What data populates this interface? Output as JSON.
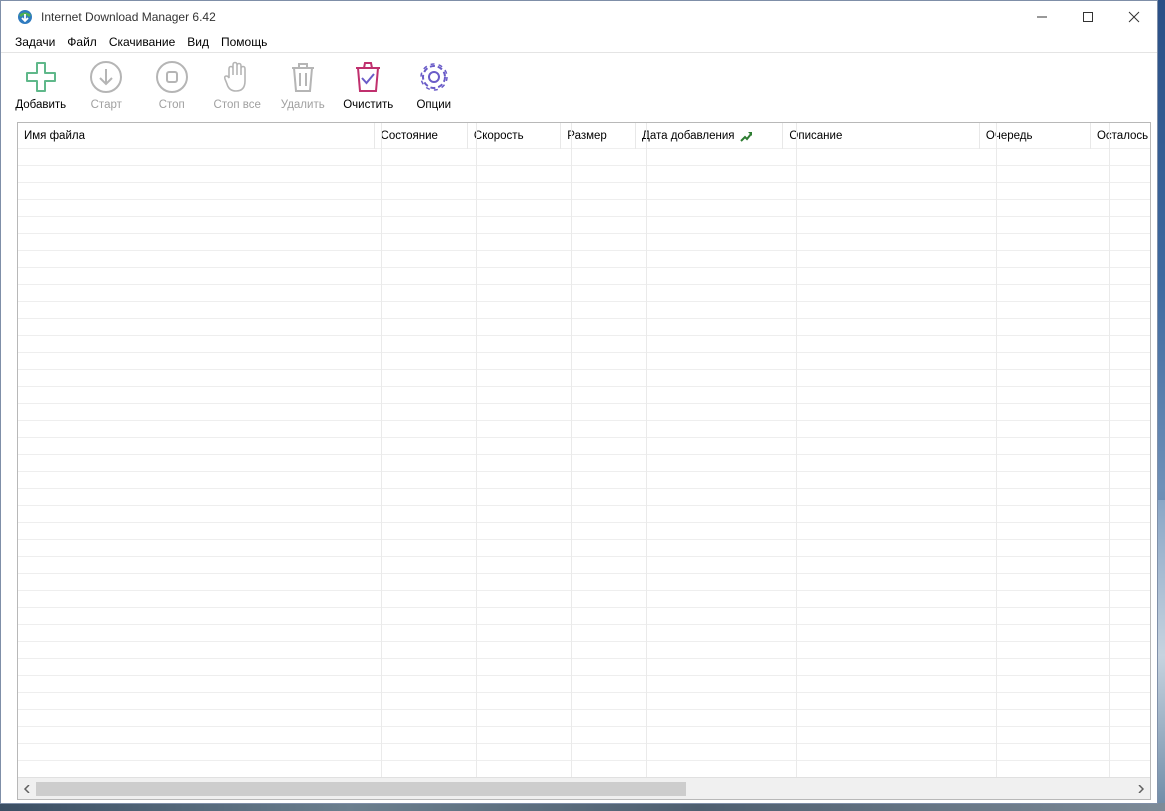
{
  "window": {
    "title": "Internet Download Manager 6.42"
  },
  "menu": [
    "Задачи",
    "Файл",
    "Скачивание",
    "Вид",
    "Помощь"
  ],
  "toolbar": [
    {
      "label": "Добавить",
      "icon": "add-icon",
      "enabled": true
    },
    {
      "label": "Старт",
      "icon": "download-arrow-icon",
      "enabled": false
    },
    {
      "label": "Стоп",
      "icon": "stop-icon",
      "enabled": false
    },
    {
      "label": "Стоп все",
      "icon": "hand-icon",
      "enabled": false
    },
    {
      "label": "Удалить",
      "icon": "trash-icon",
      "enabled": false
    },
    {
      "label": "Очистить",
      "icon": "clear-icon",
      "enabled": true
    },
    {
      "label": "Опции",
      "icon": "gear-icon",
      "enabled": true
    }
  ],
  "columns": [
    "Имя файла",
    "Состояние",
    "Скорость",
    "Размер",
    "Дата добавления",
    "Описание",
    "Очередь",
    "Осталось"
  ],
  "sort_column": "Дата добавления",
  "colors": {
    "add": "#5fb88a",
    "clear": "#c0306e",
    "options": "#6a5cc8",
    "disabled": "#b5b5b5"
  }
}
